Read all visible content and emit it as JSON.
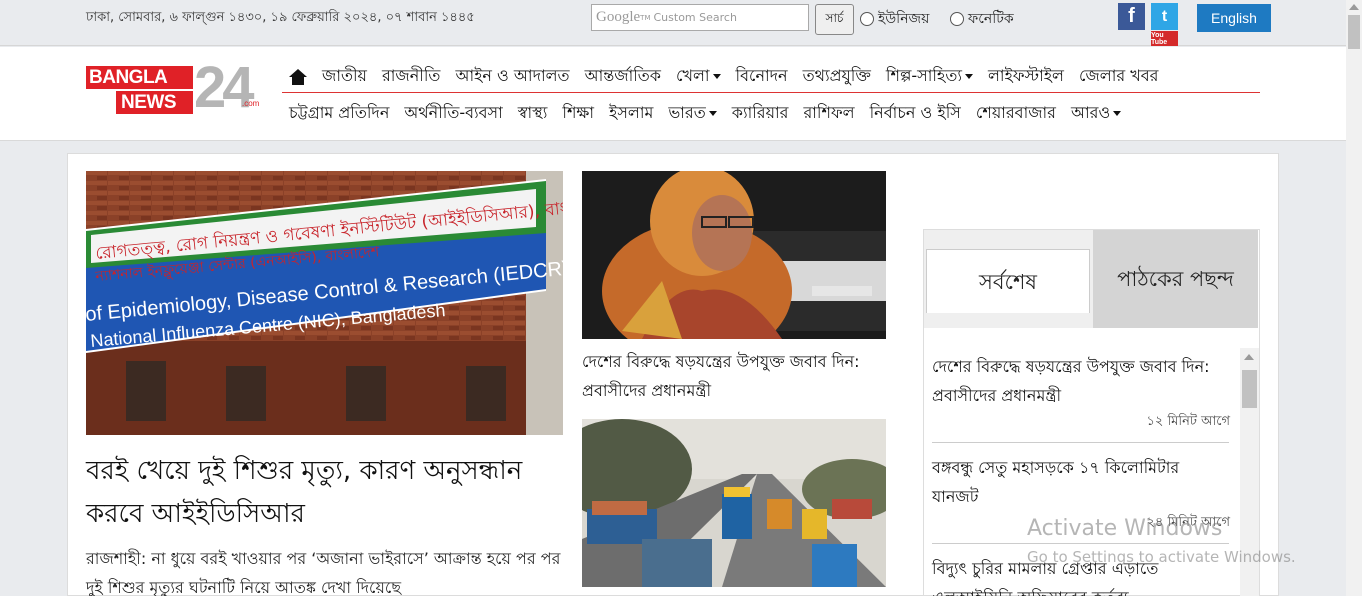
{
  "topbar": {
    "date": "ঢাকা, সোমবার, ৬ ফাল্গুন ১৪৩০, ১৯ ফেব্রুয়ারি ২০২৪, ০৭ শাবান ১৪৪৫",
    "search_brand": "Google",
    "search_brand_sup": "TM",
    "search_placeholder": "Custom Search",
    "search_button": "সার্চ",
    "radio_unijoy": "ইউনিজয়",
    "radio_phonetic": "ফনেটিক",
    "facebook_label": "f",
    "twitter_label": "t",
    "youtube_label": "You Tube",
    "english_button": "English"
  },
  "logo": {
    "line1": "BANGLA",
    "line2": "NEWS",
    "number": "24",
    "suffix": ".com"
  },
  "nav": {
    "row1": [
      {
        "label": "জাতীয়"
      },
      {
        "label": "রাজনীতি"
      },
      {
        "label": "আইন ও আদালত"
      },
      {
        "label": "আন্তর্জাতিক"
      },
      {
        "label": "খেলা"
      },
      {
        "label": "বিনোদন"
      },
      {
        "label": "তথ্যপ্রযুক্তি"
      },
      {
        "label": "শিল্প-সাহিত্য"
      },
      {
        "label": "লাইফস্টাইল"
      },
      {
        "label": "জেলার খবর"
      }
    ],
    "row2": [
      {
        "label": "চট্টগ্রাম প্রতিদিন"
      },
      {
        "label": "অর্থনীতি-ব্যবসা"
      },
      {
        "label": "স্বাস্থ্য"
      },
      {
        "label": "শিক্ষা"
      },
      {
        "label": "ইসলাম"
      },
      {
        "label": "ভারত"
      },
      {
        "label": "ক্যারিয়ার"
      },
      {
        "label": "রাশিফল"
      },
      {
        "label": "নির্বাচন ও ইসি"
      },
      {
        "label": "শেয়ারবাজার"
      },
      {
        "label": "আরও"
      }
    ]
  },
  "lead": {
    "sign_line1": "রোগতত্ত্ব, রোগ নিয়ন্ত্রণ ও গবেষণা ইনস্টিটিউট (আইইডিসিআর), বাংলাদেশ",
    "sign_line2": "ন্যাশনাল ইনফ্লুয়েঞ্জা সেন্টার (এনআইসি), বাংলাদেশ",
    "sign_line3": "of Epidemiology, Disease Control & Research (IEDCR)",
    "sign_line4": "National Influenza Centre (NIC), Bangladesh",
    "title": "বরই খেয়ে দুই শিশুর মৃত্যু, কারণ অনুসন্ধান করবে আইইডিসিআর",
    "summary": "রাজশাহী: না ধুয়ে বরই খাওয়ার পর ‘অজানা ভাইরাসে’ আক্রান্ত হয়ে পর পর দুই শিশুর মৃত্যুর ঘটনাটি নিয়ে আতঙ্ক দেখা দিয়েছে"
  },
  "story2": {
    "title": "দেশের বিরুদ্ধে ষড়যন্ত্রের উপযুক্ত জবাব দিন: প্রবাসীদের প্রধানমন্ত্রী"
  },
  "sidebar": {
    "tab_latest": "সর্বশেষ",
    "tab_popular": "পাঠকের পছন্দ",
    "items": [
      {
        "title": "দেশের বিরুদ্ধে ষড়যন্ত্রের উপযুক্ত জবাব দিন: প্রবাসীদের প্রধানমন্ত্রী",
        "time": "১২ মিনিট আগে"
      },
      {
        "title": "বঙ্গবন্ধু সেতু মহাসড়কে ১৭ কিলোমিটার যানজট",
        "time": "২৪ মিনিট আগে"
      },
      {
        "title": "বিদ্যুৎ চুরির মামলায় গ্রেপ্তার এড়াতে এলআইসিনি অফিসারের কর্তব্য",
        "time": ""
      }
    ]
  },
  "watermark": {
    "line1": "Activate Windows",
    "line2": "Go to Settings to activate Windows."
  },
  "colors": {
    "brand_red": "#e02127",
    "english_button": "#1e7ac2",
    "nav_rule": "#dd3333"
  }
}
